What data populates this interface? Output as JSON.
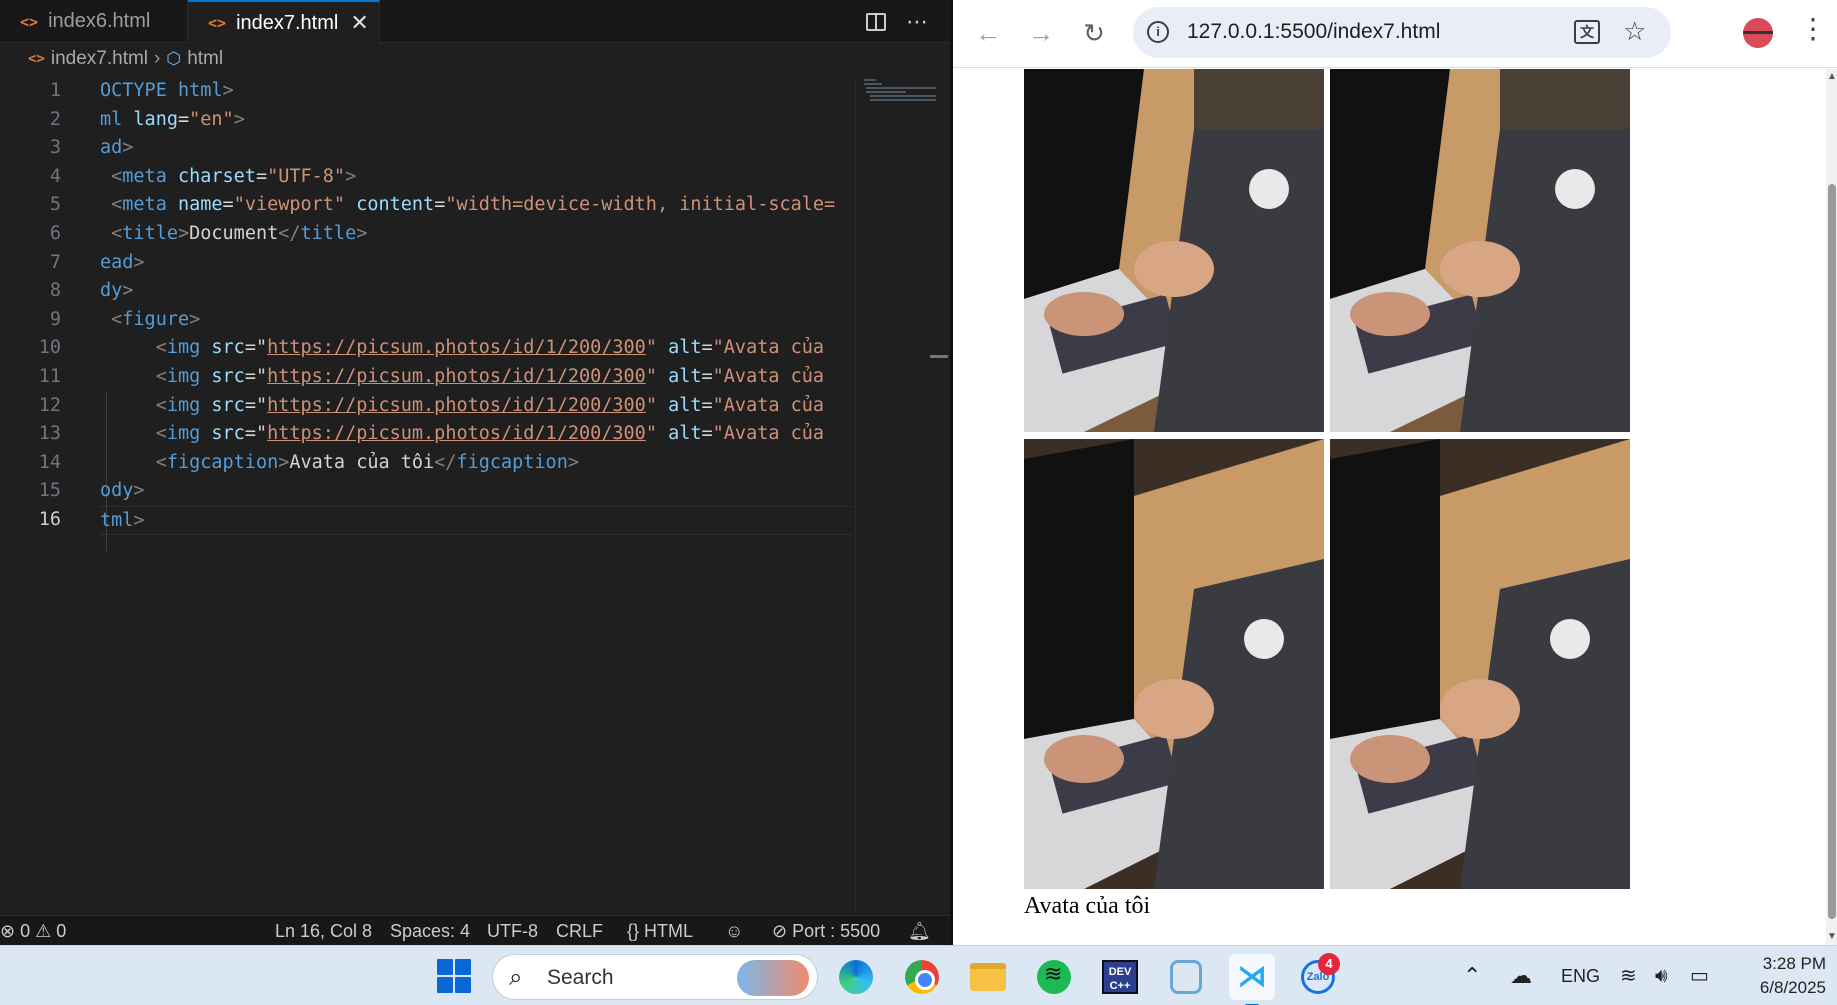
{
  "editor": {
    "tabs": [
      {
        "label": "index6.html",
        "icon": "html-file-icon"
      },
      {
        "label": "index7.html",
        "icon": "html-file-icon",
        "active": true
      }
    ],
    "breadcrumb": {
      "file": "index7.html",
      "symbol": "html"
    },
    "line_numbers": [
      "1",
      "2",
      "3",
      "4",
      "5",
      "6",
      "7",
      "8",
      "9",
      "10",
      "11",
      "12",
      "13",
      "14",
      "15",
      "16"
    ],
    "current_line": "16",
    "status": {
      "errors": "0",
      "warnings": "0",
      "cursor": "Ln 16, Col 8",
      "spaces": "Spaces: 4",
      "encoding": "UTF-8",
      "eol": "CRLF",
      "language": "HTML",
      "port": "Port : 5500"
    },
    "colors": {
      "accent": "#0078d4",
      "tag": "#569cd6",
      "attr": "#9cdcfe",
      "string": "#ce9178"
    }
  },
  "code": {
    "l1_a": "OCTYPE",
    "l1_b": "html",
    "l2_a": "ml",
    "l2_attr": "lang",
    "l2_val": "\"en\"",
    "l3_a": "ad",
    "l4_tag": "meta",
    "l4_attr": "charset",
    "l4_val": "\"UTF-8\"",
    "l5_tag": "meta",
    "l5_attr1": "name",
    "l5_val1": "\"viewport\"",
    "l5_attr2": "content",
    "l5_val2": "\"width=device-width, initial-scale=",
    "l6_tag": "title",
    "l6_text": "Document",
    "l7_a": "ead",
    "l8_a": "dy",
    "l9_tag": "figure",
    "img_tag": "img",
    "img_src_attr": "src",
    "img_url": "https://picsum.photos/id/1/200/300",
    "img_alt_attr": "alt",
    "img_alt_val": "\"Avata của",
    "l14_tag": "figcaption",
    "l14_text": "Avata của tôi",
    "l15_a": "ody",
    "l16_a": "tml"
  },
  "browser": {
    "url": "127.0.0.1:5500/index7.html",
    "caption": "Avata của tôi",
    "avatar_color": "#d94b59"
  },
  "taskbar": {
    "search_placeholder": "Search",
    "apps": [
      "edge-icon",
      "chrome-icon",
      "file-explorer-icon",
      "spotify-icon",
      "devcpp-icon",
      "ghost-app-icon",
      "vscode-icon",
      "zalo-icon"
    ],
    "dev_label": "DEV C++",
    "zalo_label": "Zalo",
    "zalo_badge": "4",
    "language": "ENG",
    "time": "3:28 PM",
    "date": "6/8/2025"
  }
}
